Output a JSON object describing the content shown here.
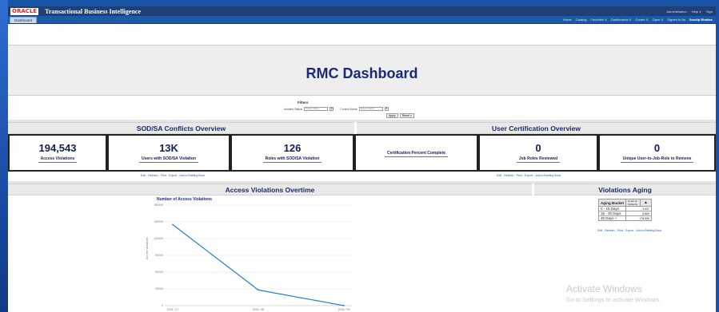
{
  "app": {
    "logo": "ORACLE",
    "title": "Transactional Business Intelligence",
    "top_links": [
      "Administration",
      "Help ∨",
      "Sign"
    ]
  },
  "tabs": [
    {
      "label": "Dashboard"
    }
  ],
  "nav": {
    "items": [
      "Home",
      "Catalog",
      "Favorites ∨",
      "Dashboards ∨",
      "Create ∨",
      "Open ∨"
    ],
    "signed_in_as": "Signed In As",
    "user": "Sandip Bhattac"
  },
  "dashboard": {
    "title": "RMC Dashboard"
  },
  "filters": {
    "title": "Filters",
    "incident_status_label": "Incident Status",
    "control_name_label": "Control Name",
    "placeholder": "Select Value",
    "apply_label": "Apply",
    "reset_label": "Reset ∨"
  },
  "sections": {
    "sod": "SOD/SA Conflicts Overview",
    "user_cert": "User Certification Overview",
    "overtime": "Access Violations Overtime",
    "aging": "Violations Aging"
  },
  "kpis": [
    {
      "value": "194,543",
      "label": "Access Violations"
    },
    {
      "value": "13K",
      "label": "Users with SOD/SA Violation"
    },
    {
      "value": "126",
      "label": "Roles with SOD/SA Violation"
    },
    {
      "value": "",
      "label": "Certification Percent Complete"
    },
    {
      "value": "0",
      "label": "Job Roles Reviewed"
    },
    {
      "value": "0",
      "label": "Unique User-to-Job-Role to Remove"
    }
  ],
  "links": {
    "edit": "Edit",
    "refresh": "Refresh",
    "print": "Print",
    "export": "Export",
    "briefing": "Add to Briefing Book",
    "sep": "-"
  },
  "chart_data": {
    "type": "line",
    "title": "Number of Access Violations",
    "ylabel": "Access Violations",
    "xlabel": "",
    "x": [
      "2024 / 07",
      "2024 / 08",
      "2024 / 09"
    ],
    "series": [
      {
        "values": [
          145000,
          28000,
          0
        ]
      }
    ],
    "ylim": [
      0,
      180000
    ],
    "yticks": [
      "0",
      "30000",
      "60000",
      "90000",
      "120000",
      "150000",
      "180000"
    ],
    "grid": true,
    "color": "#2a7fd0"
  },
  "aging": {
    "header_bucket": "Aging Bucket",
    "header_count": "Count of Incidents",
    "rows": [
      {
        "bucket": "0 - 15 Days",
        "count": "3,537"
      },
      {
        "bucket": "16 - 30 Days",
        "count": "8,860"
      },
      {
        "bucket": "45 Days +",
        "count": "178,806"
      }
    ]
  },
  "watermark": {
    "line1": "Activate Windows",
    "line2": "Go to Settings to activate Windows."
  }
}
